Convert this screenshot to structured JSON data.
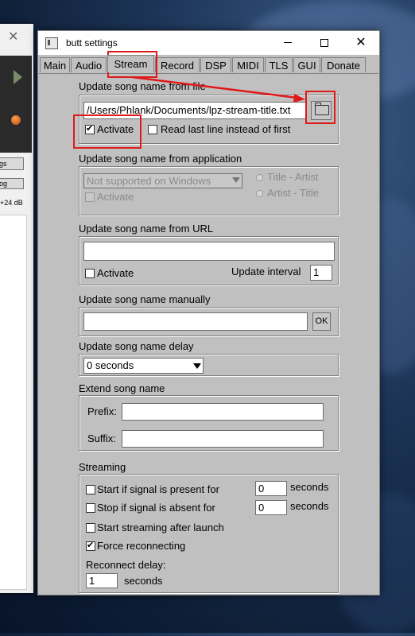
{
  "background_window": {
    "btn1": "gs",
    "btn2": "og",
    "db_label": "+24 dB"
  },
  "window": {
    "title": "butt settings",
    "controls": {
      "minimize": "—",
      "maximize": "□",
      "close": "✕"
    }
  },
  "tabs": [
    "Main",
    "Audio",
    "Stream",
    "Record",
    "DSP",
    "MIDI",
    "TLS",
    "GUI",
    "Donate"
  ],
  "active_tab": "Stream",
  "song_file": {
    "title": "Update song name from file",
    "path": "/Users/Phlank/Documents/lpz-stream-title.txt",
    "activate_label": "Activate",
    "activate_checked": true,
    "read_last_line_label": "Read last line instead of first",
    "read_last_line_checked": false
  },
  "song_app": {
    "title": "Update song name from application",
    "app_select": "Not supported on Windows",
    "radio1": "Title - Artist",
    "radio2": "Artist - Title",
    "activate_label": "Activate"
  },
  "song_url": {
    "title": "Update song name from URL",
    "url_value": "",
    "activate_label": "Activate",
    "interval_label": "Update interval",
    "interval_value": "1"
  },
  "song_manual": {
    "title": "Update song name manually",
    "value": "",
    "ok_label": "OK"
  },
  "song_delay": {
    "title": "Update song name delay",
    "selected": "0 seconds"
  },
  "extend": {
    "title": "Extend song name",
    "prefix_label": "Prefix:",
    "suffix_label": "Suffix:",
    "prefix_value": "",
    "suffix_value": ""
  },
  "streaming": {
    "title": "Streaming",
    "start_signal_label": "Start if signal is present for",
    "start_signal_value": "0",
    "stop_signal_label": "Stop if signal is absent for",
    "stop_signal_value": "0",
    "seconds_label": "seconds",
    "start_after_launch_label": "Start streaming after launch",
    "force_reconnect_label": "Force reconnecting",
    "force_reconnect_checked": true,
    "reconnect_delay_label": "Reconnect delay:",
    "reconnect_delay_value": "1"
  },
  "colors": {
    "annotation": "#e01919",
    "window_bg": "#c0c0c0"
  }
}
